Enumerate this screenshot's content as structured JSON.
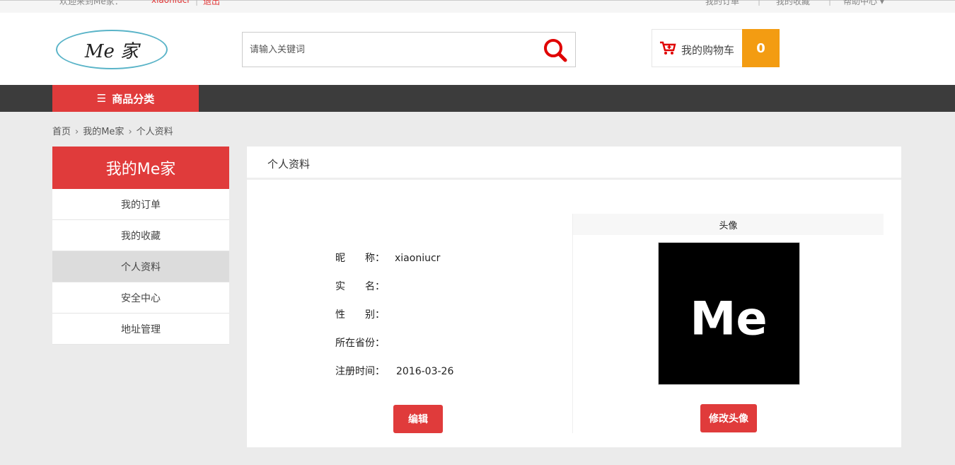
{
  "topbar": {
    "welcome": "欢迎来到Me家：",
    "username": "xiaoniucr",
    "logout": "退出",
    "links": [
      "我的订单",
      "我的收藏",
      "帮助中心"
    ]
  },
  "header": {
    "logo_text": "Me 家",
    "search_placeholder": "请输入关键词",
    "cart_label": "我的购物车",
    "cart_count": "0"
  },
  "nav": {
    "category_label": "商品分类"
  },
  "breadcrumb": [
    "首页",
    "我的Me家",
    "个人资料"
  ],
  "sidebar": {
    "title": "我的Me家",
    "items": [
      "我的订单",
      "我的收藏",
      "个人资料",
      "安全中心",
      "地址管理"
    ],
    "active_index": 2
  },
  "profile": {
    "panel_title": "个人资料",
    "fields": [
      {
        "label": "昵　　称：",
        "value": "xiaoniucr"
      },
      {
        "label": "实　　名：",
        "value": ""
      },
      {
        "label": "性　　别：",
        "value": ""
      },
      {
        "label": "所在省份：",
        "value": ""
      },
      {
        "label": "注册时间：",
        "value": "2016-03-26"
      }
    ],
    "edit_button": "编辑",
    "avatar_title": "头像",
    "avatar_text": "Me",
    "avatar_button": "修改头像"
  },
  "colors": {
    "accent": "#e03b3b",
    "cart_badge": "#f39c12",
    "nav_bg": "#3c3c3c"
  }
}
